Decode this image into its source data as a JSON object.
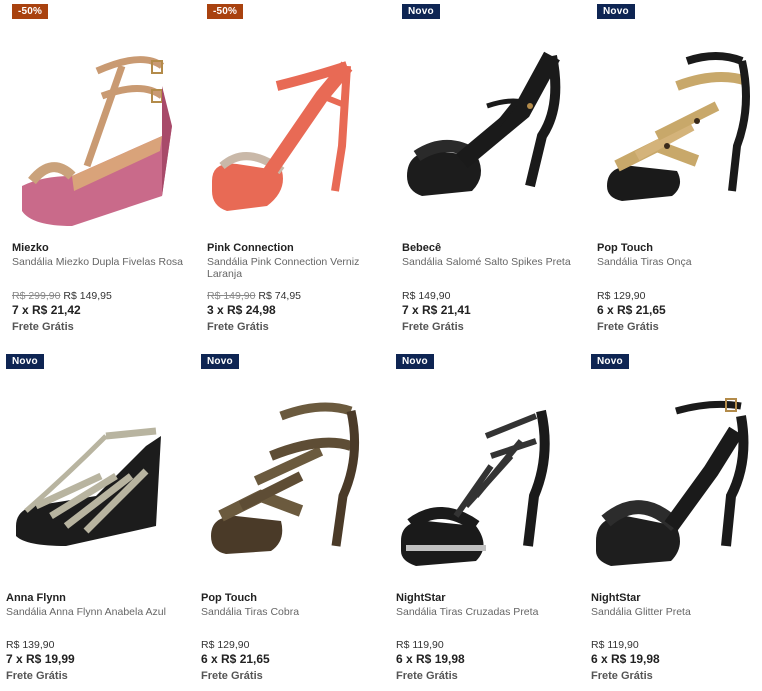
{
  "colors": {
    "sale_badge": "#a9420f",
    "new_badge": "#0e2553"
  },
  "products": [
    {
      "badge": "-50%",
      "badge_type": "sale",
      "brand": "Miezko",
      "desc": "Sandália Miezko Dupla Fivelas Rosa",
      "old_price": "R$ 299,90",
      "price": "R$ 149,95",
      "installments": "7 x R$ 21,42",
      "shipping": "Frete Grátis",
      "icon": "tan-pink-wedge-sandal"
    },
    {
      "badge": "-50%",
      "badge_type": "sale",
      "brand": "Pink Connection",
      "desc": "Sandália Pink Connection Verniz Laranja",
      "old_price": "R$ 149,90",
      "price": "R$ 74,95",
      "installments": "3 x R$ 24,98",
      "shipping": "Frete Grátis",
      "icon": "coral-platform-sandal"
    },
    {
      "badge": "Novo",
      "badge_type": "new",
      "brand": "Bebecê",
      "desc": "Sandália Salomé Salto Spikes Preta",
      "old_price": "",
      "price": "R$ 149,90",
      "installments": "7 x R$ 21,41",
      "shipping": "Frete Grátis",
      "icon": "black-tstrap-sandal"
    },
    {
      "badge": "Novo",
      "badge_type": "new",
      "brand": "Pop Touch",
      "desc": "Sandália Tiras Onça",
      "old_price": "",
      "price": "R$ 129,90",
      "installments": "6 x R$ 21,65",
      "shipping": "Frete Grátis",
      "icon": "leopard-strappy-sandal"
    },
    {
      "badge": "Novo",
      "badge_type": "new",
      "brand": "Anna Flynn",
      "desc": "Sandália Anna Flynn Anabela Azul",
      "old_price": "",
      "price": "R$ 139,90",
      "installments": "7 x R$ 19,99",
      "shipping": "Frete Grátis",
      "icon": "silver-wedge-sandal"
    },
    {
      "badge": "Novo",
      "badge_type": "new",
      "brand": "Pop Touch",
      "desc": "Sandália Tiras Cobra",
      "old_price": "",
      "price": "R$ 129,90",
      "installments": "6 x R$ 21,65",
      "shipping": "Frete Grátis",
      "icon": "snake-strappy-sandal"
    },
    {
      "badge": "Novo",
      "badge_type": "new",
      "brand": "NightStar",
      "desc": "Sandália Tiras Cruzadas Preta",
      "old_price": "",
      "price": "R$ 119,90",
      "installments": "6 x R$ 19,98",
      "shipping": "Frete Grátis",
      "icon": "black-cross-strap-sandal"
    },
    {
      "badge": "Novo",
      "badge_type": "new",
      "brand": "NightStar",
      "desc": "Sandália Glitter Preta",
      "old_price": "",
      "price": "R$ 119,90",
      "installments": "6 x R$ 19,98",
      "shipping": "Frete Grátis",
      "icon": "black-glitter-sandal"
    }
  ]
}
